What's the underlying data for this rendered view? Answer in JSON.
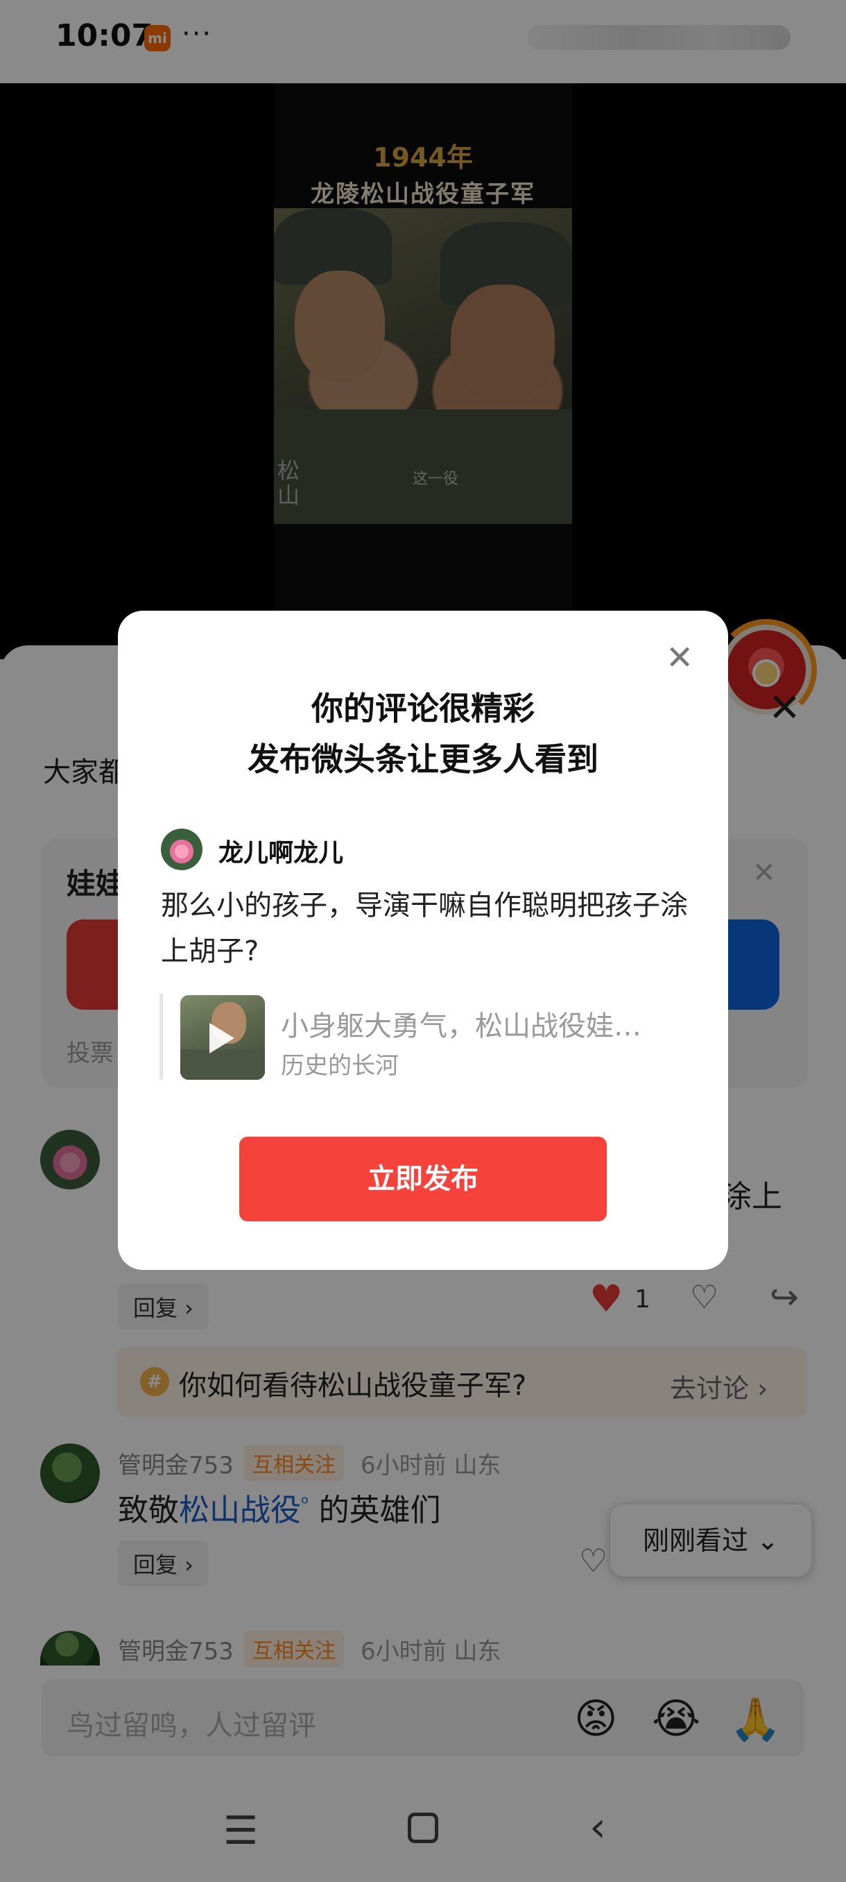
{
  "status_bar": {
    "time": "10:07",
    "badge": "mi",
    "more": "···"
  },
  "video": {
    "year": "1944年",
    "title": "龙陵松山战役童子军",
    "subtitle_left": "松山",
    "subtitle_center": "这一役"
  },
  "sheet": {
    "header_text": "大家都",
    "poll": {
      "title": "娃娃",
      "label": "投票"
    },
    "comment1": {
      "text_tail": "涂上",
      "reply_label": "回复 ›",
      "like_count": "1"
    },
    "topic": {
      "text": "你如何看待松山战役童子军?",
      "action": "去讨论 ›"
    },
    "comment2": {
      "user": "管明金753",
      "badge": "互相关注",
      "meta": "6小时前   山东",
      "text_prefix": "致敬",
      "text_link": "松山战役",
      "text_suffix": " 的英雄们",
      "reply_label": "回复 ›"
    },
    "recent_chip": "刚刚看过 ⌄",
    "comment3": {
      "user": "管明金753",
      "badge": "互相关注",
      "meta": "6小时前   山东"
    },
    "input_placeholder": "鸟过留鸣，人过留评",
    "emojis": [
      "😡",
      "😭",
      "🙏"
    ]
  },
  "dialog": {
    "title_line1": "你的评论很精彩",
    "title_line2": "发布微头条让更多人看到",
    "username": "龙儿啊龙儿",
    "comment": "那么小的孩子，导演干嘛自作聪明把孩子涂上胡子?",
    "video_title": "小身躯大勇气，松山战役娃…",
    "video_author": "历史的长河",
    "publish_button": "立即发布"
  },
  "colors": {
    "accent_red": "#f5423b",
    "link_blue": "#1a5fc8",
    "mutual_orange": "#ff8a1c"
  }
}
